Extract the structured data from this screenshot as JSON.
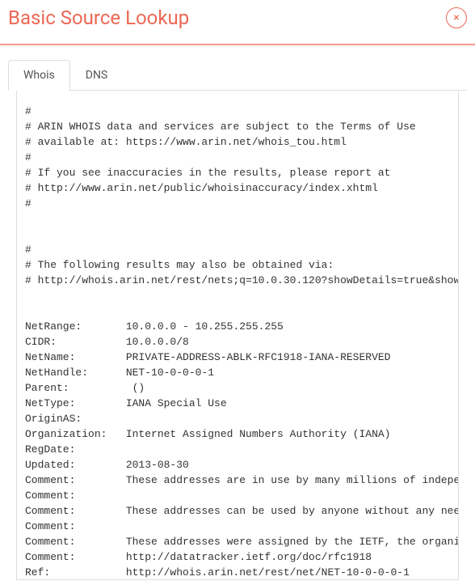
{
  "header": {
    "title": "Basic Source Lookup",
    "close_glyph": "×"
  },
  "tabs": [
    {
      "label": "Whois",
      "active": true
    },
    {
      "label": "DNS",
      "active": false
    }
  ],
  "whois_output": "#\n# ARIN WHOIS data and services are subject to the Terms of Use\n# available at: https://www.arin.net/whois_tou.html\n#\n# If you see inaccuracies in the results, please report at\n# http://www.arin.net/public/whoisinaccuracy/index.xhtml\n#\n\n\n#\n# The following results may also be obtained via:\n# http://whois.arin.net/rest/nets;q=10.0.30.120?showDetails=true&showARIN=false&showNonArinTopLevelNet=false&ext=netref2\n\n\nNetRange:       10.0.0.0 - 10.255.255.255\nCIDR:           10.0.0.0/8\nNetName:        PRIVATE-ADDRESS-ABLK-RFC1918-IANA-RESERVED\nNetHandle:      NET-10-0-0-0-1\nParent:          ()\nNetType:        IANA Special Use\nOriginAS:\nOrganization:   Internet Assigned Numbers Authority (IANA)\nRegDate:\nUpdated:        2013-08-30\nComment:        These addresses are in use by many millions of independently operated networks.\nComment:\nComment:        These addresses can be used by anyone without any need to coordinate with IANA or an Internet registry.\nComment:\nComment:        These addresses were assigned by the IETF, the organization that develops Internet protocols.\nComment:        http://datatracker.ietf.org/doc/rfc1918\nRef:            http://whois.arin.net/rest/net/NET-10-0-0-0-1"
}
